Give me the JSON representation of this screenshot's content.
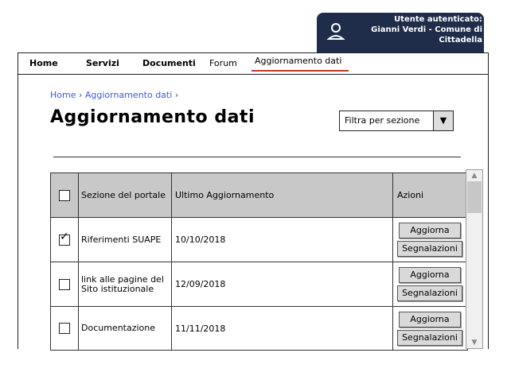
{
  "user": {
    "line1": "Utente autenticato:",
    "line2": "Gianni Verdi - Comune di",
    "line3": "Cittadella",
    "icon": "user-icon"
  },
  "nav": {
    "home": "Home",
    "servizi": "Servizi",
    "documenti": "Documenti",
    "forum": "Forum",
    "aggiornamento": "Aggiornamento dati"
  },
  "breadcrumb": {
    "home": "Home",
    "sep1": " › ",
    "current": "Aggiornamento dati",
    "sep2": " ›"
  },
  "page": {
    "title": "Aggiornamento dati"
  },
  "filter": {
    "label": "Filtra per sezione",
    "icon": "chevron-down-icon"
  },
  "table": {
    "headers": {
      "sezione": "Sezione del portale",
      "ultimo": "Ultimo Aggiornamento",
      "azioni": "Azioni"
    },
    "rows": [
      {
        "sezione": "Riferimenti SUAPE",
        "data": "10/10/2018",
        "checked": true
      },
      {
        "sezione": "link alle pagine del Sito istituzionale",
        "data": "12/09/2018",
        "checked": false
      },
      {
        "sezione": "Documentazione",
        "data": "11/11/2018",
        "checked": false
      }
    ],
    "btn_aggiorna": "Aggiorna",
    "btn_segnalazioni": "Segnalazioni"
  },
  "colors": {
    "user_box": "#1f2d4a",
    "active_underline": "#c0392b",
    "header_bg": "#c8c8c8",
    "link": "#3d5bd9"
  }
}
